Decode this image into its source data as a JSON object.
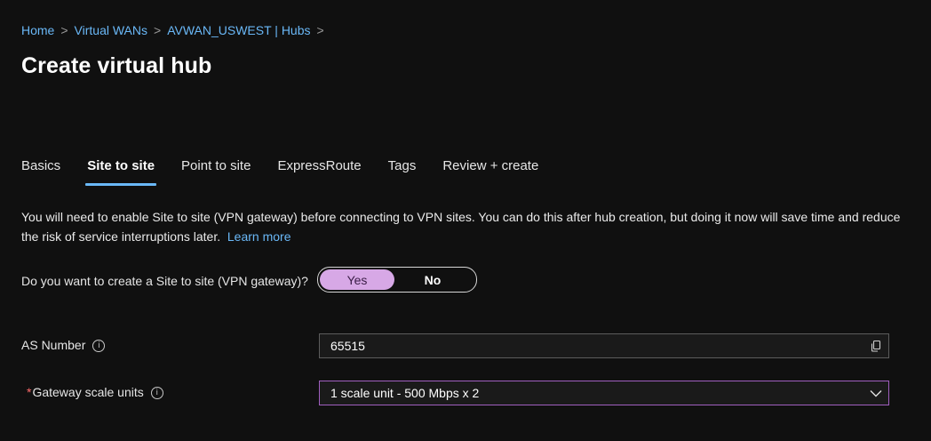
{
  "breadcrumb": {
    "items": [
      "Home",
      "Virtual WANs",
      "AVWAN_USWEST | Hubs"
    ],
    "separator": ">"
  },
  "page": {
    "title": "Create virtual hub"
  },
  "tabs": [
    {
      "label": "Basics",
      "active": false
    },
    {
      "label": "Site to site",
      "active": true
    },
    {
      "label": "Point to site",
      "active": false
    },
    {
      "label": "ExpressRoute",
      "active": false
    },
    {
      "label": "Tags",
      "active": false
    },
    {
      "label": "Review + create",
      "active": false
    }
  ],
  "info": {
    "text": "You will need to enable Site to site (VPN gateway) before connecting to VPN sites. You can do this after hub creation, but doing it now will save time and reduce the risk of service interruptions later.",
    "link": "Learn more"
  },
  "form": {
    "create_gateway": {
      "label": "Do you want to create a Site to site (VPN gateway)?",
      "options": [
        "Yes",
        "No"
      ],
      "selected": "Yes"
    },
    "as_number": {
      "label": "AS Number",
      "value": "65515"
    },
    "scale_units": {
      "required_mark": "*",
      "label": "Gateway scale units",
      "value": "1 scale unit - 500 Mbps x 2"
    }
  },
  "icons": {
    "info": "info-icon",
    "copy": "copy-icon",
    "dropdown": "chevron-down-icon"
  },
  "colors": {
    "link": "#6ab8f7",
    "toggle_selected": "#d7a8e6",
    "select_border": "#a05fbf",
    "required": "#ff6b6b"
  }
}
